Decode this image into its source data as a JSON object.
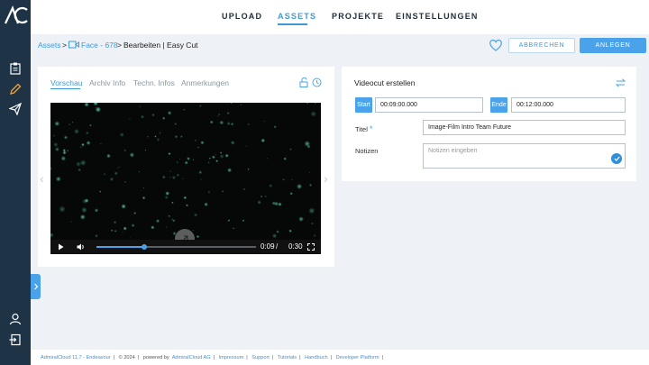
{
  "nav": {
    "items": [
      {
        "label": "UPLOAD"
      },
      {
        "label": "ASSETS"
      },
      {
        "label": "PROJEKTE"
      },
      {
        "label": "EINSTELLUNGEN"
      }
    ]
  },
  "breadcrumb": {
    "assets": "Assets",
    "sep1": ">",
    "face": "Face - 678",
    "sep2": ">",
    "current": "Bearbeiten | Easy Cut"
  },
  "actions": {
    "cancel": "ABBRECHEN",
    "create": "ANLEGEN"
  },
  "preview": {
    "tabs": [
      "Vorschau",
      "Archiv Info",
      "Techn. Infos",
      "Anmerkungen"
    ],
    "time_current": "0:09",
    "time_sep": "/",
    "time_total": "0:30",
    "progress": 0.3
  },
  "cut": {
    "title": "Videocut erstellen",
    "start_label": "Start",
    "start_value": "00:09:00.000",
    "end_label": "Ende",
    "end_value": "00:12:00.000",
    "title_label": "Titel",
    "title_value": "Image-Film Intro Team Future",
    "notes_label": "Notizen",
    "notes_placeholder": "Notizen eingeben"
  },
  "footer": {
    "version": "AdmiralCloud 11.7 - Endeavour",
    "copyright": "© 2024",
    "powered": "powered by",
    "company": "AdmiralCloud AG",
    "links": [
      "Impressum",
      "Support",
      "Tutorials",
      "Handbuch",
      "Developer Platform"
    ]
  },
  "colors": {
    "accent": "#3d9ad8",
    "sidebar": "#1f3346",
    "button": "#4aa3ea"
  },
  "icons": [
    "logo",
    "clipboard-icon",
    "pencil-icon",
    "send-icon",
    "user-icon",
    "logout-icon",
    "heart-icon",
    "unlock-icon",
    "clock-icon",
    "swap-icon",
    "check-icon",
    "play-icon",
    "volume-icon",
    "fullscreen-icon",
    "video-camera-icon"
  ]
}
